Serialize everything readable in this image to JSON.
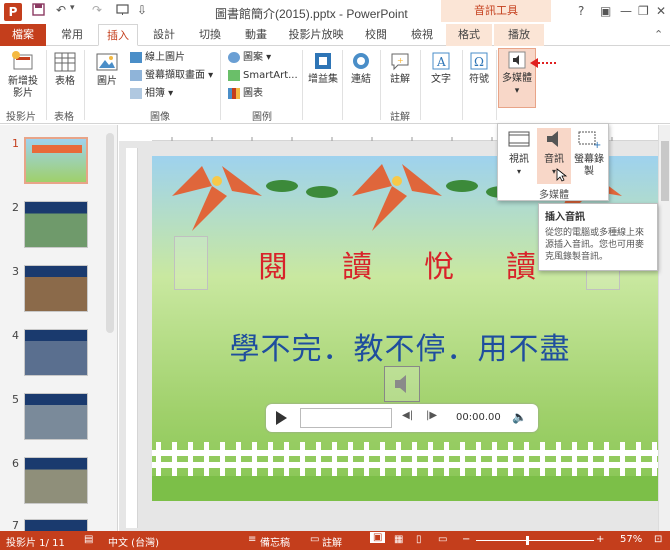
{
  "titlebar": {
    "title": "圖書館簡介(2015).pptx - PowerPoint",
    "context_tools": "音訊工具",
    "help": "?",
    "minimize": "—",
    "restore": "❐",
    "close": "✕"
  },
  "tabs": {
    "file": "檔案",
    "home": "常用",
    "insert": "插入",
    "design": "設計",
    "transitions": "切換",
    "animations": "動畫",
    "slideshow": "投影片放映",
    "review": "校閱",
    "view": "檢視",
    "format": "格式",
    "playback": "播放"
  },
  "ribbon": {
    "new_slide": "新增投影片",
    "table": "表格",
    "picture": "圖片",
    "online_pictures": "線上圖片",
    "screenshot": "螢幕擷取畫面",
    "album": "相簿",
    "shapes": "圖案",
    "smartart": "SmartArt...",
    "chart": "圖表",
    "addins": "增益集",
    "links": "連結",
    "comment": "註解",
    "text": "文字",
    "symbols": "符號",
    "media": "多媒體",
    "groups": {
      "slides": "投影片",
      "tables": "表格",
      "images": "圖像",
      "illustrations": "圖例",
      "comments": "註解"
    }
  },
  "media_dropdown": {
    "video": "視訊",
    "audio": "音訊",
    "screen_recording": "螢幕錄製",
    "group_label": "多媒體"
  },
  "tooltip": {
    "title": "插入音訊",
    "body": "從您的電腦或多種線上來源插入音訊。您也可用麥克風錄製音訊。"
  },
  "slides": {
    "numbers": [
      "1",
      "2",
      "3",
      "4",
      "5",
      "6",
      "7"
    ]
  },
  "slide": {
    "title_chars": [
      "閱",
      "讀",
      "悅",
      "讀"
    ],
    "subtitle": "學不完．教不停．用不盡",
    "player_time": "00:00.00"
  },
  "statusbar": {
    "slide_info": "投影片 1/ 11",
    "language": "中文 (台灣)",
    "notes": "備忘稿",
    "comments": "註解",
    "zoom": "57%"
  },
  "colors": {
    "accent": "#c43e1c",
    "context_tab": "#fbe5d6",
    "title_red": "#d8232a",
    "subtitle_blue": "#1f4e9e"
  }
}
